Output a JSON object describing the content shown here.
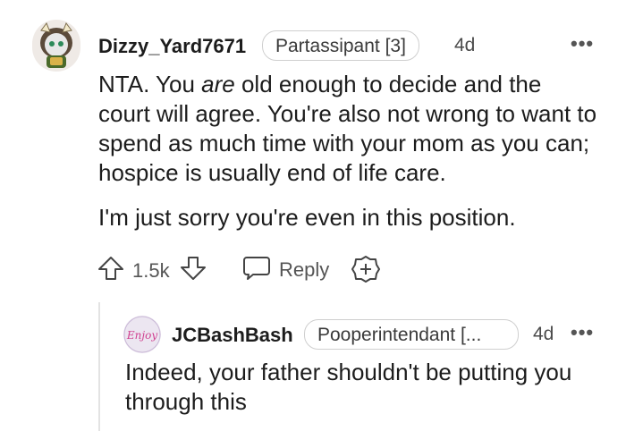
{
  "comment": {
    "username": "Dizzy_Yard7671",
    "flair": "Partassipant [3]",
    "age": "4d",
    "more_label": "•••",
    "body_p1_pre": "NTA. You ",
    "body_p1_em": "are",
    "body_p1_post": " old enough to decide and the court will agree. You're also not wrong to want to spend as much time with your mom as you can; hospice is usually end of life care.",
    "body_p2": "I'm just sorry you're even in this position.",
    "score": "1.5k",
    "reply_label": "Reply"
  },
  "reply": {
    "username": "JCBashBash",
    "flair": "Pooperintendant [...",
    "age": "4d",
    "more_label": "•••",
    "body": "Indeed, your father shouldn't be putting you through this",
    "avatar_text": "Enjoy"
  },
  "colors": {
    "text": "#1c1c1c",
    "muted": "#555555",
    "flair_border": "#cfcfcf",
    "thread_line": "#e3e3e3",
    "avatar1_bg": "#efeae6",
    "avatar2_bg": "#ece6f1",
    "avatar2_text": "#d04090"
  }
}
